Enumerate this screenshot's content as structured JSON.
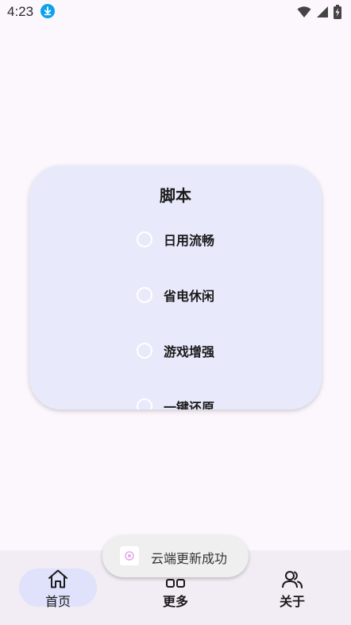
{
  "status_bar": {
    "time": "4:23",
    "download_icon": "download-icon",
    "icons": [
      "wifi-icon",
      "signal-icon",
      "battery-charging-icon"
    ],
    "accent": "#0aa2e8"
  },
  "script_card": {
    "title": "脚本",
    "options": [
      {
        "label": "日用流畅"
      },
      {
        "label": "省电休闲"
      },
      {
        "label": "游戏增强"
      },
      {
        "label": "一键还原"
      }
    ],
    "background": "#e8eafb"
  },
  "bottom_nav": {
    "items": [
      {
        "label": "首页",
        "icon": "home-icon",
        "selected": true
      },
      {
        "label": "更多",
        "icon": "grid-icon",
        "selected": false
      },
      {
        "label": "关于",
        "icon": "people-icon",
        "selected": false
      }
    ],
    "pill_color": "#dfe2fa"
  },
  "toast": {
    "message": "云端更新成功",
    "icon": "app-icon"
  }
}
